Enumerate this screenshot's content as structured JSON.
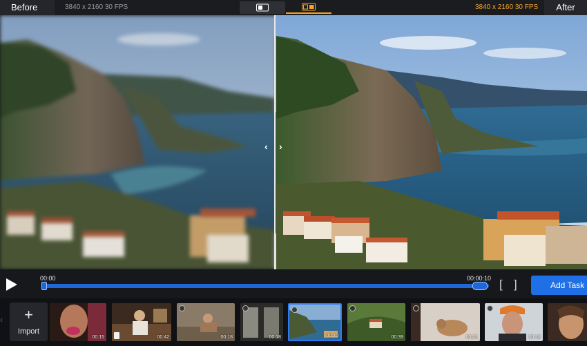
{
  "topbar": {
    "before_label": "Before",
    "after_label": "After",
    "source_info": "3840 x 2160  30 FPS",
    "output_info": "3840 x 2160  30 FPS",
    "accent_color": "#f4a62a"
  },
  "preview": {
    "left_arrow": "‹",
    "right_arrow": "›"
  },
  "player": {
    "time_start": "00:00",
    "time_end": "00:00:10",
    "bracket_open": "[",
    "bracket_close": "]",
    "add_task_label": "Add Task",
    "progress_fraction": 1.0
  },
  "strip": {
    "import_plus": "+",
    "import_label": "Import",
    "thumbnails": [
      {
        "duration": "00:15"
      },
      {
        "duration": "00:42"
      },
      {
        "duration": "00:18"
      },
      {
        "duration": "00:18"
      },
      {
        "duration": "00:10"
      },
      {
        "duration": "00:39"
      },
      {
        "duration": "00:21"
      },
      {
        "duration": "00:18"
      },
      {
        "duration": ""
      }
    ]
  }
}
